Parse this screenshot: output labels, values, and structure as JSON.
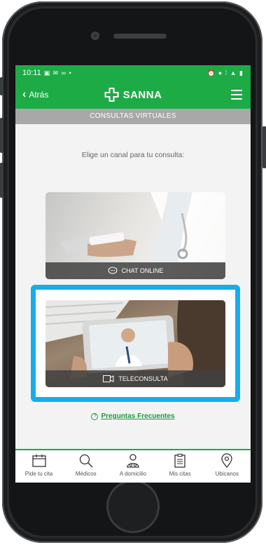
{
  "status": {
    "time": "10:11",
    "left_icons": "▣ ✉ ∞ •",
    "right_icons": "⏰ ● ⁞ ▲ ▮"
  },
  "header": {
    "back_label": "Atrás",
    "brand": "SANNA"
  },
  "section_title": "CONSULTAS VIRTUALES",
  "prompt": "Elige un canal para tu consulta:",
  "cards": [
    {
      "label": "CHAT ONLINE",
      "icon": "chat-icon"
    },
    {
      "label": "TELECONSULTA",
      "icon": "video-icon"
    }
  ],
  "faq": {
    "label": "Preguntas Frecuentes",
    "icon_text": "?"
  },
  "tabs": [
    {
      "label": "Pide tu cita",
      "icon": "calendar-icon"
    },
    {
      "label": "Médicos",
      "icon": "search-icon"
    },
    {
      "label": "A domicilio",
      "icon": "doctor-icon"
    },
    {
      "label": "Mis citas",
      "icon": "clipboard-icon"
    },
    {
      "label": "Ubicanos",
      "icon": "location-pin-icon"
    }
  ],
  "colors": {
    "brand_green": "#1dab46",
    "highlight_blue": "#16aee8",
    "section_gray": "#a8a8a8"
  }
}
